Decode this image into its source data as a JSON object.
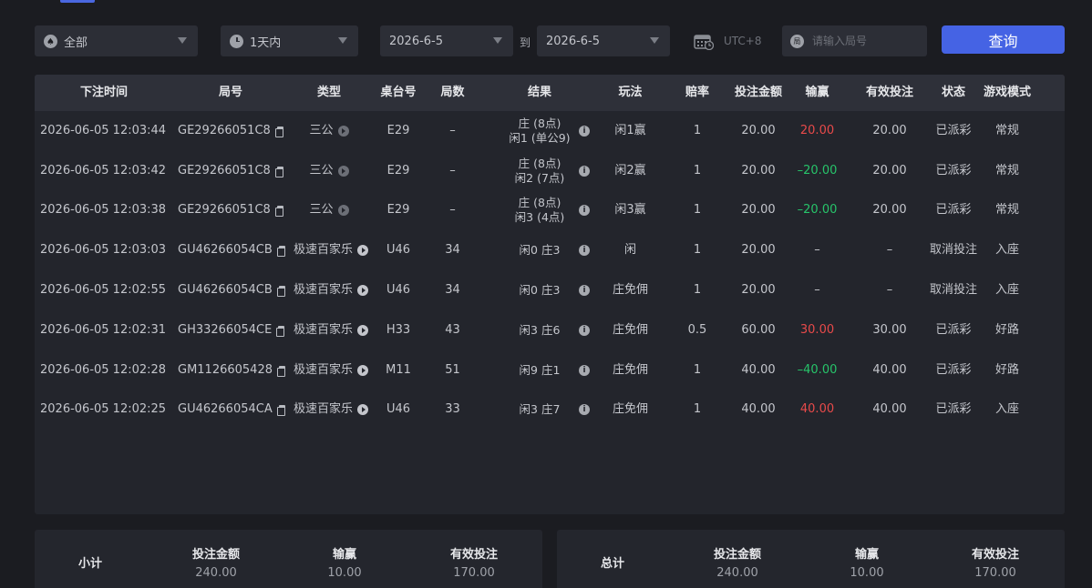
{
  "filters": {
    "game_type": "全部",
    "period": "1天内",
    "date_from": "2026-6-5",
    "to_label": "到",
    "date_to": "2026-6-5",
    "timezone": "UTC+8",
    "round_search_placeholder": "请输入局号",
    "round_search_icon_text": "局",
    "query_label": "查询"
  },
  "table": {
    "headers": [
      "下注时间",
      "局号",
      "类型",
      "桌台号",
      "局数",
      "结果",
      "玩法",
      "赔率",
      "投注金额",
      "输赢",
      "有效投注",
      "状态",
      "游戏模式"
    ],
    "rows": [
      {
        "time": "2026-06-05 12:03:44",
        "round": "GE29266051C8",
        "type": "三公",
        "table": "E29",
        "count": "–",
        "result": [
          "庄 (8点)",
          "闲1 (单公9)"
        ],
        "play": "闲1赢",
        "odds": "1",
        "amount": "20.00",
        "winloss": "20.00",
        "wl_sign": "pos",
        "valid": "20.00",
        "status": "已派彩",
        "mode": "常规"
      },
      {
        "time": "2026-06-05 12:03:42",
        "round": "GE29266051C8",
        "type": "三公",
        "table": "E29",
        "count": "–",
        "result": [
          "庄 (8点)",
          "闲2 (7点)"
        ],
        "play": "闲2赢",
        "odds": "1",
        "amount": "20.00",
        "winloss": "–20.00",
        "wl_sign": "neg",
        "valid": "20.00",
        "status": "已派彩",
        "mode": "常规"
      },
      {
        "time": "2026-06-05 12:03:38",
        "round": "GE29266051C8",
        "type": "三公",
        "table": "E29",
        "count": "–",
        "result": [
          "庄 (8点)",
          "闲3 (4点)"
        ],
        "play": "闲3赢",
        "odds": "1",
        "amount": "20.00",
        "winloss": "–20.00",
        "wl_sign": "neg",
        "valid": "20.00",
        "status": "已派彩",
        "mode": "常规"
      },
      {
        "time": "2026-06-05 12:03:03",
        "round": "GU46266054CB",
        "type": "极速百家乐",
        "table": "U46",
        "count": "34",
        "result": [
          "闲0 庄3"
        ],
        "play": "闲",
        "odds": "1",
        "amount": "20.00",
        "winloss": "–",
        "wl_sign": "none",
        "valid": "–",
        "status": "取消投注",
        "mode": "入座"
      },
      {
        "time": "2026-06-05 12:02:55",
        "round": "GU46266054CB",
        "type": "极速百家乐",
        "table": "U46",
        "count": "34",
        "result": [
          "闲0 庄3"
        ],
        "play": "庄免佣",
        "odds": "1",
        "amount": "20.00",
        "winloss": "–",
        "wl_sign": "none",
        "valid": "–",
        "status": "取消投注",
        "mode": "入座"
      },
      {
        "time": "2026-06-05 12:02:31",
        "round": "GH33266054CE",
        "type": "极速百家乐",
        "table": "H33",
        "count": "43",
        "result": [
          "闲3 庄6"
        ],
        "play": "庄免佣",
        "odds": "0.5",
        "amount": "60.00",
        "winloss": "30.00",
        "wl_sign": "pos",
        "valid": "30.00",
        "status": "已派彩",
        "mode": "好路"
      },
      {
        "time": "2026-06-05 12:02:28",
        "round": "GM1126605428",
        "type": "极速百家乐",
        "table": "M11",
        "count": "51",
        "result": [
          "闲9 庄1"
        ],
        "play": "庄免佣",
        "odds": "1",
        "amount": "40.00",
        "winloss": "–40.00",
        "wl_sign": "neg",
        "valid": "40.00",
        "status": "已派彩",
        "mode": "好路"
      },
      {
        "time": "2026-06-05 12:02:25",
        "round": "GU46266054CA",
        "type": "极速百家乐",
        "table": "U46",
        "count": "33",
        "result": [
          "闲3 庄7"
        ],
        "play": "庄免佣",
        "odds": "1",
        "amount": "40.00",
        "winloss": "40.00",
        "wl_sign": "pos",
        "valid": "40.00",
        "status": "已派彩",
        "mode": "入座"
      }
    ]
  },
  "subtotal": {
    "label": "小计",
    "amount_label": "投注金额",
    "amount": "240.00",
    "winloss_label": "输赢",
    "winloss": "10.00",
    "valid_label": "有效投注",
    "valid": "170.00"
  },
  "total": {
    "label": "总计",
    "amount_label": "投注金额",
    "amount": "240.00",
    "winloss_label": "输赢",
    "winloss": "10.00",
    "valid_label": "有效投注",
    "valid": "170.00"
  },
  "colors": {
    "accent": "#4563e4",
    "win": "#e84a4a",
    "loss": "#27c46a"
  }
}
